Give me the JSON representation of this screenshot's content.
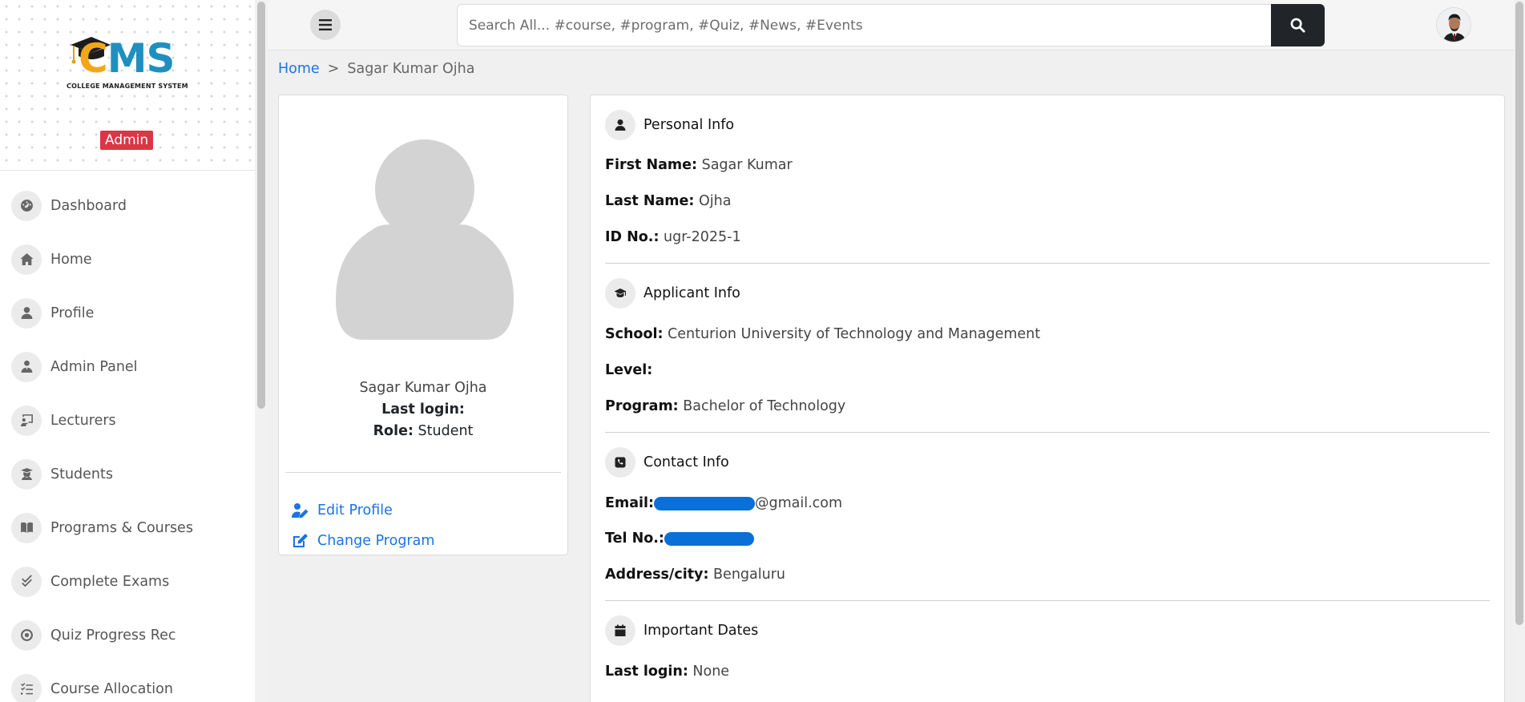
{
  "sidebar": {
    "logo_text_c": "C",
    "logo_text_ms": "MS",
    "logo_subtitle": "COLLEGE MANAGEMENT SYSTEM",
    "role_badge": "Admin",
    "items": [
      {
        "label": "Dashboard",
        "icon": "dashboard-icon"
      },
      {
        "label": "Home",
        "icon": "home-icon"
      },
      {
        "label": "Profile",
        "icon": "user-icon"
      },
      {
        "label": "Admin Panel",
        "icon": "admin-icon"
      },
      {
        "label": "Lecturers",
        "icon": "chalkboard-teacher-icon"
      },
      {
        "label": "Students",
        "icon": "graduate-icon"
      },
      {
        "label": "Programs & Courses",
        "icon": "book-icon"
      },
      {
        "label": "Complete Exams",
        "icon": "check-double-icon"
      },
      {
        "label": "Quiz Progress Rec",
        "icon": "record-icon"
      },
      {
        "label": "Course Allocation",
        "icon": "list-check-icon"
      }
    ]
  },
  "topbar": {
    "search_placeholder": "Search All... #course, #program, #Quiz, #News, #Events"
  },
  "breadcrumb": {
    "home": "Home",
    "separator": ">",
    "current": "Sagar Kumar Ojha"
  },
  "profile_card": {
    "name": "Sagar Kumar Ojha",
    "last_login_label": "Last login:",
    "role_label": "Role:",
    "role_value": "Student",
    "edit_profile": "Edit Profile",
    "change_program": "Change Program"
  },
  "details": {
    "personal": {
      "title": "Personal Info",
      "first_name_label": "First Name:",
      "first_name": "Sagar Kumar",
      "last_name_label": "Last Name:",
      "last_name": "Ojha",
      "id_label": "ID No.:",
      "id": "ugr-2025-1"
    },
    "applicant": {
      "title": "Applicant Info",
      "school_label": "School:",
      "school": "Centurion University of Technology and Management",
      "level_label": "Level:",
      "level": "",
      "program_label": "Program:",
      "program": "Bachelor of Technology"
    },
    "contact": {
      "title": "Contact Info",
      "email_label": "Email:",
      "email_visible": "@gmail.com",
      "tel_label": "Tel No.:",
      "address_label": "Address/city:",
      "address": "Bengaluru"
    },
    "dates": {
      "title": "Important Dates",
      "last_login_label": "Last login:",
      "last_login": "None"
    }
  },
  "colors": {
    "accent": "#1a73e8",
    "badge": "#dc3545",
    "search_button": "#212529"
  }
}
